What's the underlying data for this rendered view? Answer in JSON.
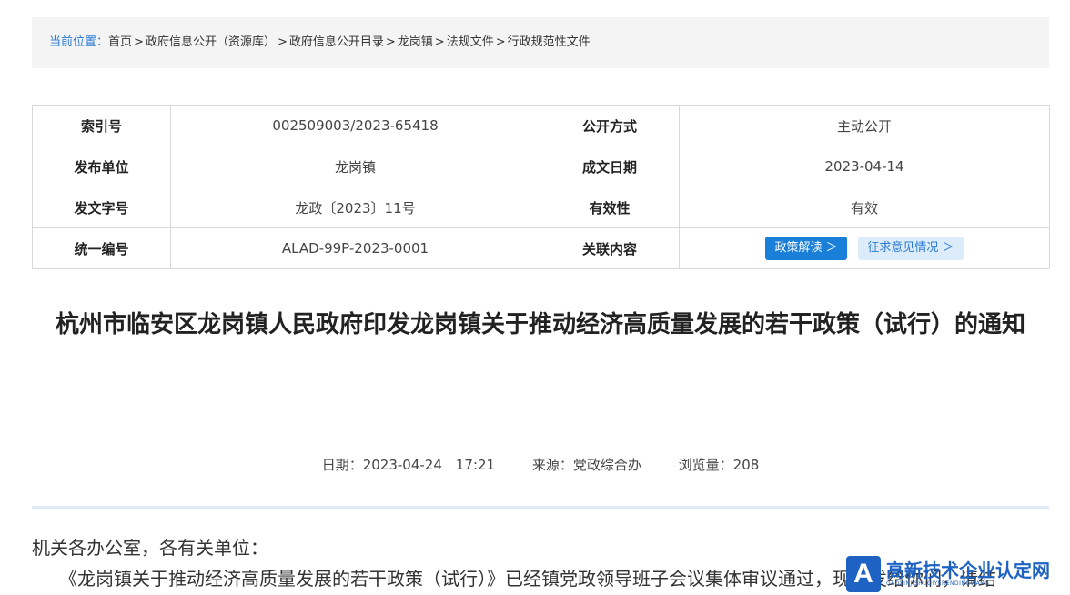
{
  "breadcrumb": {
    "label": "当前位置：",
    "items": [
      "首页",
      "政府信息公开（资源库）",
      "政府信息公开目录",
      "龙岗镇",
      "法规文件",
      "行政规范性文件"
    ],
    "separator": ">"
  },
  "meta": {
    "rows": [
      {
        "k1": "索引号",
        "v1": "002509003/2023-65418",
        "k2": "公开方式",
        "v2": "主动公开"
      },
      {
        "k1": "发布单位",
        "v1": "龙岗镇",
        "k2": "成文日期",
        "v2": "2023-04-14"
      },
      {
        "k1": "发文字号",
        "v1": "龙政〔2023〕11号",
        "k2": "有效性",
        "v2": "有效"
      },
      {
        "k1": "统一编号",
        "v1": "ALAD-99P-2023-0001",
        "k2": "关联内容"
      }
    ],
    "buttons": {
      "policy": "政策解读 ＞",
      "opinion": "征求意见情况 ＞"
    }
  },
  "article": {
    "title": "杭州市临安区龙岗镇人民政府印发龙岗镇关于推动经济高质量发展的若干政策（试行）的通知",
    "date": "日期：2023-04-24　17:21",
    "source": "来源：党政综合办",
    "views": "浏览量：208",
    "salutation": "机关各办公室，各有关单位：",
    "paragraph1": "《龙岗镇关于推动经济高质量发展的若干政策（试行）》已经镇党政领导班子会议集体审议通过，现印发给你们，请结"
  },
  "watermark": {
    "logo": "A",
    "main": "高新技术企业认定网",
    "sub": "GAOXINJISHUQIYERENDINGWANG"
  },
  "colors": {
    "accent": "#1a7fd8",
    "breadcrumb_bg": "#f4f4f4",
    "divider": "#e0ebf7"
  }
}
